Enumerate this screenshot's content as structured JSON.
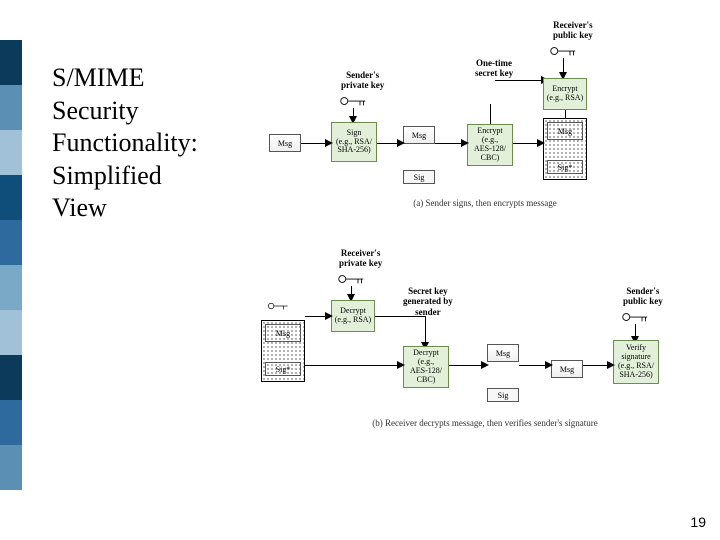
{
  "slide": {
    "title": "S/MIME\nSecurity\nFunctionality:\nSimplified\nView",
    "page_number": "19"
  },
  "diagram": {
    "receiver_public_key": "Receiver's\npublic key",
    "sender_private_key": "Sender's\nprivate key",
    "receiver_private_key": "Receiver's\nprivate key",
    "sender_public_key": "Sender's\npublic key",
    "one_time_secret_key": "One-time\nsecret key",
    "secret_key_label": "Secret key\ngenerated by\nsender",
    "msg": "Msg",
    "sig": "Sig",
    "sig_asterisk": "Sig*",
    "sign": "Sign\n(e.g., RSA/\nSHA-256)",
    "verify": "Verify\nsignature\n(e.g., RSA/\nSHA-256)",
    "encrypt_rsa": "Encrypt\n(e.g., RSA)",
    "decrypt_rsa": "Decrypt\n(e.g., RSA)",
    "encrypt_aes": "Encrypt\n(e.g.,\nAES-128/\nCBC)",
    "decrypt_aes": "Decrypt\n(e.g.,\nAES-128/\nCBC)",
    "caption_a": "(a) Sender signs, then encrypts message",
    "caption_b": "(b) Receiver decrypts message, then verifies sender's signature"
  }
}
